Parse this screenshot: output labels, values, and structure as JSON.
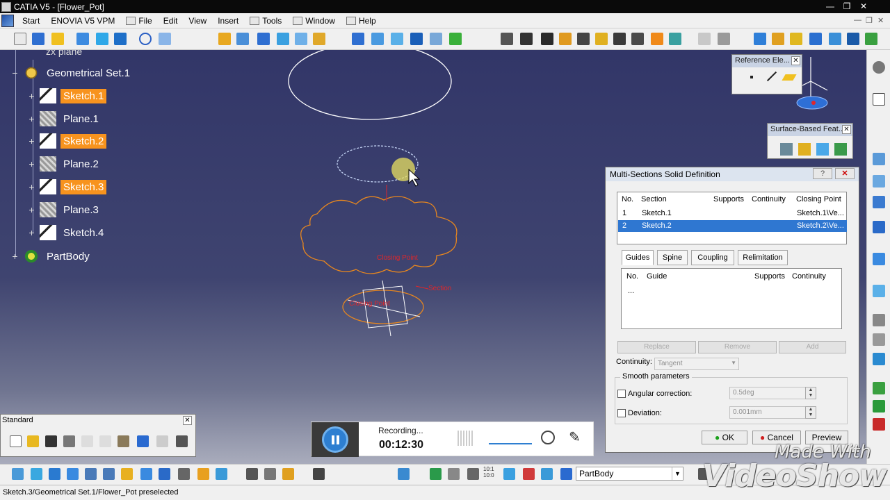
{
  "window": {
    "title": "CATIA V5 - [Flower_Pot]"
  },
  "menu": {
    "items": [
      "Start",
      "ENOVIA V5 VPM",
      "File",
      "Edit",
      "View",
      "Insert",
      "Tools",
      "Window",
      "Help"
    ]
  },
  "tree": {
    "partial_top": "zx plane",
    "nodes": [
      {
        "label": "Geometrical Set.1",
        "icon": "geometrical-set-icon",
        "highlighted": false
      },
      {
        "label": "Sketch.1",
        "icon": "sketch-icon",
        "highlighted": true
      },
      {
        "label": "Plane.1",
        "icon": "plane-icon",
        "highlighted": false
      },
      {
        "label": "Sketch.2",
        "icon": "sketch-icon",
        "highlighted": true
      },
      {
        "label": "Plane.2",
        "icon": "plane-icon",
        "highlighted": false
      },
      {
        "label": "Sketch.3",
        "icon": "sketch-icon",
        "highlighted": true
      },
      {
        "label": "Plane.3",
        "icon": "plane-icon",
        "highlighted": false
      },
      {
        "label": "Sketch.4",
        "icon": "sketch-icon",
        "highlighted": false
      },
      {
        "label": "PartBody",
        "icon": "partbody-icon",
        "highlighted": false
      }
    ]
  },
  "reference_panel": {
    "title": "Reference Ele..."
  },
  "surface_panel": {
    "title": "Surface-Based Feat..."
  },
  "dialog": {
    "title": "Multi-Sections Solid Definition",
    "sections": {
      "headers": {
        "no": "No.",
        "section": "Section",
        "supports": "Supports",
        "continuity": "Continuity",
        "closing": "Closing Point"
      },
      "rows": [
        {
          "no": "1",
          "section": "Sketch.1",
          "closing": "Sketch.1\\Ve...",
          "selected": false
        },
        {
          "no": "2",
          "section": "Sketch.2",
          "closing": "Sketch.2\\Ve...",
          "selected": true
        }
      ]
    },
    "tabs": [
      "Guides",
      "Spine",
      "Coupling",
      "Relimitation"
    ],
    "guides": {
      "headers": {
        "no": "No.",
        "guide": "Guide",
        "supports": "Supports",
        "continuity": "Continuity"
      },
      "placeholder_row": "..."
    },
    "buttons": {
      "replace": "Replace",
      "remove": "Remove",
      "add": "Add"
    },
    "continuity_label": "Continuity:",
    "continuity_value": "Tangent",
    "smooth_title": "Smooth parameters",
    "angular_label": "Angular correction:",
    "angular_value": "0.5deg",
    "deviation_label": "Deviation:",
    "deviation_value": "0.001mm",
    "ok": "OK",
    "cancel": "Cancel",
    "preview": "Preview"
  },
  "standard_toolbar": {
    "title": "Standard"
  },
  "recorder": {
    "status": "Recording...",
    "time": "00:12:30"
  },
  "bottom": {
    "combo_value": "PartBody",
    "zoom_label": "10:1\n10:0"
  },
  "status": {
    "text": "Sketch.3/Geometrical Set.1/Flower_Pot preselected"
  },
  "watermark": {
    "line1": "Made With",
    "line2": "VideoShow"
  },
  "viewport_labels": {
    "closing_point": "Closing Point",
    "section": "Section"
  },
  "colors": {
    "highlight": "#f7931e",
    "selection": "#2f77d1",
    "sketch_white": "#ffffff",
    "sketch_orange": "#e8871e",
    "label_red": "#e0262a"
  }
}
